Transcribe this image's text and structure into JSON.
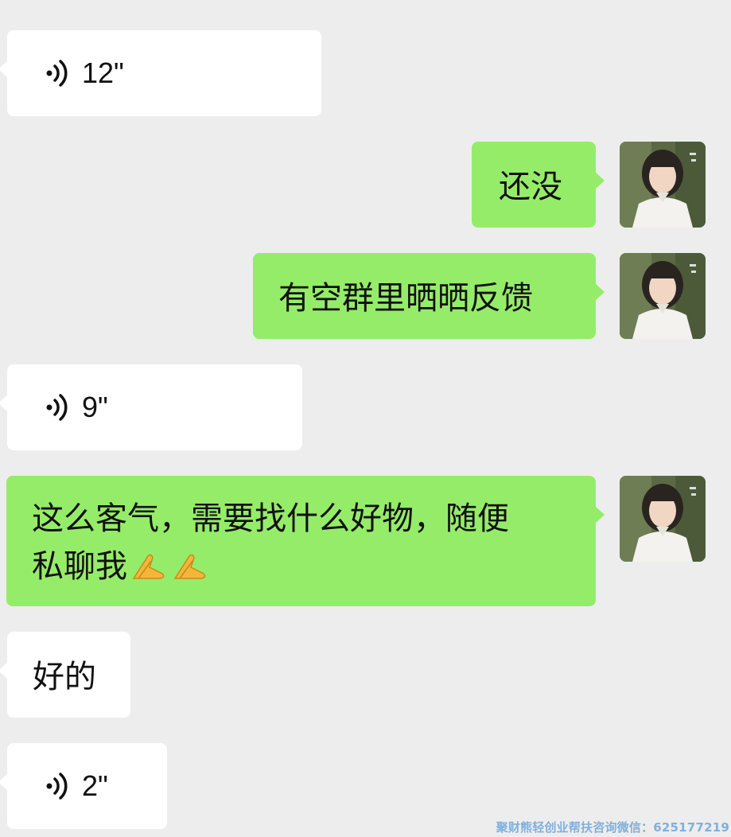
{
  "messages": [
    {
      "side": "left",
      "type": "voice",
      "duration": "12\""
    },
    {
      "side": "right",
      "type": "text",
      "text": "还没"
    },
    {
      "side": "right",
      "type": "text",
      "text": "有空群里晒晒反馈"
    },
    {
      "side": "left",
      "type": "voice",
      "duration": "9\""
    },
    {
      "side": "right",
      "type": "text",
      "line1": "这么客气，需要找什么好物，随便",
      "line2": "私聊我",
      "emoji": "🙏🙏"
    },
    {
      "side": "left",
      "type": "text",
      "text": "好的"
    },
    {
      "side": "left",
      "type": "voice",
      "duration": "2\""
    }
  ],
  "watermark": "聚财熊轻创业帮扶咨询微信：625177219",
  "icons": {
    "voice": "voice-wave-icon",
    "avatar": "avatar",
    "emoji": "folded-hands-emoji"
  },
  "colors": {
    "background": "#ededed",
    "incoming_bubble": "#ffffff",
    "outgoing_bubble": "#95ec69",
    "watermark": "#7fb0de"
  }
}
